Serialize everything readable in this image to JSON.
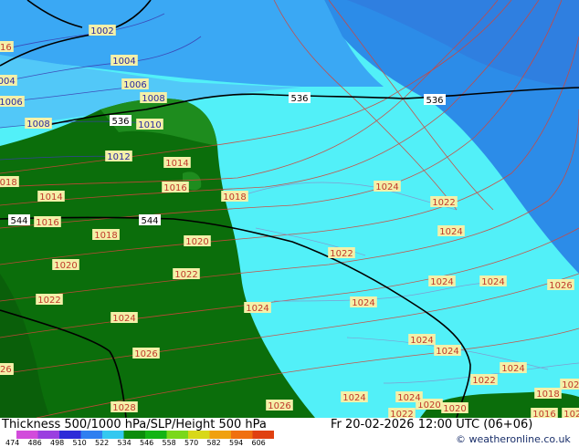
{
  "footer": {
    "title": "Thickness 500/1000 hPa/SLP/Height 500 hPa",
    "datetime": "Fr 20-02-2026 12:00 UTC (06+06)",
    "copyright": "© weatheronline.co.uk"
  },
  "legend": {
    "ticks": [
      "474",
      "486",
      "498",
      "510",
      "522",
      "534",
      "546",
      "558",
      "570",
      "582",
      "594",
      "606"
    ],
    "colors": [
      "#d24cdb",
      "#9a3fe0",
      "#2d2bd8",
      "#2f7ff0",
      "#33c8f0",
      "#0b8c0b",
      "#12b414",
      "#7ad81a",
      "#d8d818",
      "#f0a010",
      "#f07010",
      "#e04010"
    ]
  },
  "colors": {
    "sea_cyan": "#52f0f8",
    "land_dark_green": "#0b6e0b",
    "land_green": "#1e8c1e",
    "blue_region": "#3aa0f2",
    "blue_dark": "#2c82e6",
    "isobar": "#2a2aa0",
    "thickness_line": "#c0392b",
    "height_line": "#000000",
    "slp_label_bg": "#f4f0a8"
  },
  "height_labels": [
    "536",
    "536",
    "536",
    "544",
    "544"
  ],
  "slp_labels": [
    "1002",
    "1004",
    "1006",
    "1008",
    "1010",
    "1004",
    "1006",
    "1008",
    "1012",
    "1014",
    "1016",
    "1018",
    "1018",
    "1016",
    "1014",
    "1020",
    "1020",
    "1022",
    "1022",
    "1024",
    "1024",
    "1026",
    "1028",
    "1026",
    "1024",
    "1024",
    "1024",
    "1024",
    "1024",
    "1022",
    "1024",
    "1024",
    "1026",
    "1022",
    "1024",
    "1020",
    "1018",
    "1016",
    "1018",
    "1016",
    "1022",
    "1024",
    "1026",
    "1020",
    "1022",
    "1024",
    "1026",
    "1018",
    "1016",
    "1026"
  ]
}
